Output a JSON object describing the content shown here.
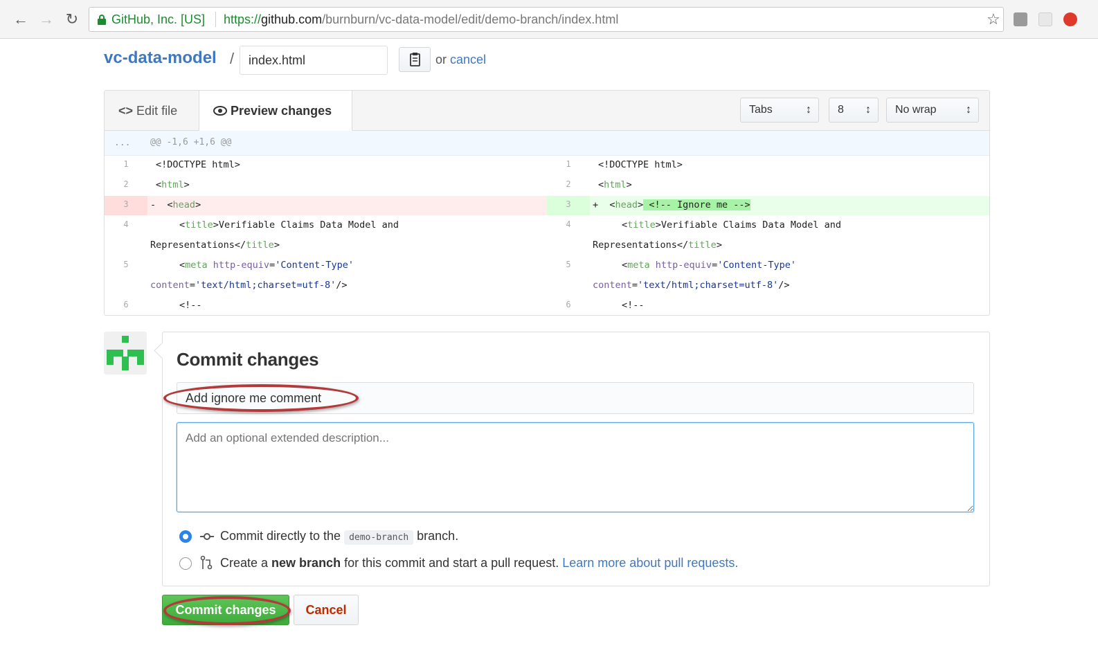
{
  "browser": {
    "ev_label": "GitHub, Inc. [US]",
    "url_scheme": "https://",
    "url_host": "github.com",
    "url_path": "/burnburn/vc-data-model/edit/demo-branch/index.html",
    "icons": [
      "back-arrow-icon",
      "forward-arrow-icon",
      "reload-icon",
      "lock-icon",
      "star-icon",
      "extension-icon",
      "opera-icon"
    ]
  },
  "header": {
    "repo_name": "vc-data-model",
    "slash": "/",
    "filename": "index.html",
    "or_text": "or ",
    "cancel_link": "cancel"
  },
  "editor": {
    "tabs": {
      "edit": "Edit file",
      "preview": "Preview changes"
    },
    "selects": {
      "indent_mode": "Tabs",
      "indent_size": "8",
      "wrap_mode": "No wrap"
    },
    "hunk_dots": "...",
    "hunk_header": "@@ -1,6 +1,6 @@",
    "line_numbers": [
      "1",
      "2",
      "3",
      "4",
      "5",
      "6"
    ],
    "left": {
      "l1": "<!DOCTYPE html>",
      "l2_open": "<",
      "l2_tag": "html",
      "l2_close": ">",
      "l3_marker": "-",
      "l3_open": "<",
      "l3_tag": "head",
      "l3_close": ">",
      "l4a_open": "<",
      "l4a_tag": "title",
      "l4a_text": ">Verifiable Claims Data Model and",
      "l4b_text": "Representations</",
      "l4b_tag": "title",
      "l4b_close": ">",
      "l5a_open": "<",
      "l5a_tag": "meta",
      "l5a_attr": " http-equiv",
      "l5a_eq": "=",
      "l5a_str": "'Content-Type'",
      "l5b_attr": "content",
      "l5b_eq": "=",
      "l5b_str": "'text/html;charset=utf-8'",
      "l5b_close": "/>",
      "l6": "<!--"
    },
    "right": {
      "l1": "<!DOCTYPE html>",
      "l2_open": "<",
      "l2_tag": "html",
      "l2_close": ">",
      "l3_marker": "+",
      "l3_open": "<",
      "l3_tag": "head",
      "l3_close": ">",
      "l3_added": " <!-- Ignore me -->",
      "l4a_open": "<",
      "l4a_tag": "title",
      "l4a_text": ">Verifiable Claims Data Model and",
      "l4b_text": "Representations</",
      "l4b_tag": "title",
      "l4b_close": ">",
      "l5a_open": "<",
      "l5a_tag": "meta",
      "l5a_attr": " http-equiv",
      "l5a_eq": "=",
      "l5a_str": "'Content-Type'",
      "l5b_attr": "content",
      "l5b_eq": "=",
      "l5b_str": "'text/html;charset=utf-8'",
      "l5b_close": "/>",
      "l6": "<!--"
    }
  },
  "commit": {
    "title": "Commit changes",
    "summary_value": "Add ignore me comment",
    "description_placeholder": "Add an optional extended description...",
    "option_direct_prefix": "Commit directly to the ",
    "branch_name": "demo-branch",
    "option_direct_suffix": " branch.",
    "option_new_prefix": "Create a ",
    "option_new_bold": "new branch",
    "option_new_middle": " for this commit and start a pull request. ",
    "option_new_link": "Learn more about pull requests.",
    "commit_button": "Commit changes",
    "cancel_button": "Cancel"
  },
  "colors": {
    "link_blue": "#4078c0",
    "ev_green": "#1a8e2f",
    "commit_green": "#3dac3a",
    "cancel_red": "#bd2c00",
    "annotation_red": "#b23a3a"
  }
}
